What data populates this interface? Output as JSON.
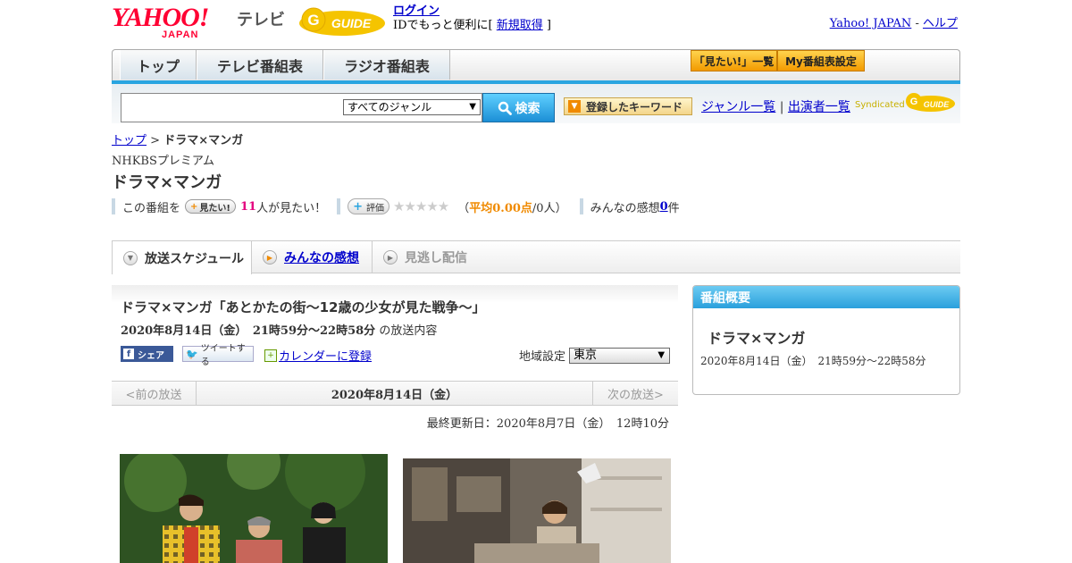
{
  "header": {
    "logo_main": "YAHOO!",
    "logo_sub": "JAPAN",
    "logo_tv": "テレビ",
    "logo_guide": "GUIDE",
    "login_label": "ログイン",
    "login_text_before": "IDでもっと便利に[ ",
    "signup_label": "新規取得",
    "login_text_after": " ]",
    "yahoo_japan_link": "Yahoo! JAPAN",
    "link_sep": " - ",
    "help_link": "ヘルプ"
  },
  "nav": {
    "tabs": [
      "トップ",
      "テレビ番組表",
      "ラジオ番組表"
    ],
    "mitai_list_label": "「見たい!」一覧",
    "my_schedule_label": "My番組表設定"
  },
  "search": {
    "placeholder": "",
    "genre_selected": "すべてのジャンル",
    "search_button": "検索",
    "keyword_button": "登録したキーワード",
    "genre_list_link": "ジャンル一覧",
    "link_sep": " | ",
    "performer_list_link": "出演者一覧",
    "syndicated": "Syndicated",
    "guide_logo": "GUIDE"
  },
  "breadcrumb": {
    "top": "トップ",
    "sep": " > ",
    "current": "ドラマ×マンガ"
  },
  "program": {
    "channel": "NHKBSプレミアム",
    "title": "ドラマ×マンガ"
  },
  "rating": {
    "prefix": "この番組を",
    "mitai_button": "見たい!",
    "mitai_count": "11",
    "mitai_suffix": "人が見たい！",
    "hyoka_button": "評価",
    "stars": "★★★★★",
    "avg_open": "（",
    "avg_label": "平均0.00点",
    "avg_count": "/0人）",
    "review_label": "みんなの感想 ",
    "review_count": "0",
    "review_suffix": "件"
  },
  "tabs": {
    "schedule": "放送スケジュール",
    "reviews": "みんなの感想",
    "missed": "見逃し配信"
  },
  "episode": {
    "title": "ドラマ×マンガ「あとかたの街～12歳の少女が見た戦争～」",
    "date_bold": "2020年8月14日（金）　21時59分～22時58分",
    "date_suffix": " の放送内容",
    "share_fb": "シェア",
    "share_tw": "ツイートする",
    "calendar": "カレンダーに登録",
    "region_label": "地域設定",
    "region_value": "東京"
  },
  "pager": {
    "prev": "<前の放送",
    "date": "2020年8月14日（金）",
    "next": "次の放送>"
  },
  "updated": "最終更新日：2020年8月7日（金）　12時10分",
  "sidebar": {
    "heading": "番組概要",
    "title": "ドラマ×マンガ",
    "date": "2020年8月14日（金）　21時59分～22時58分"
  }
}
